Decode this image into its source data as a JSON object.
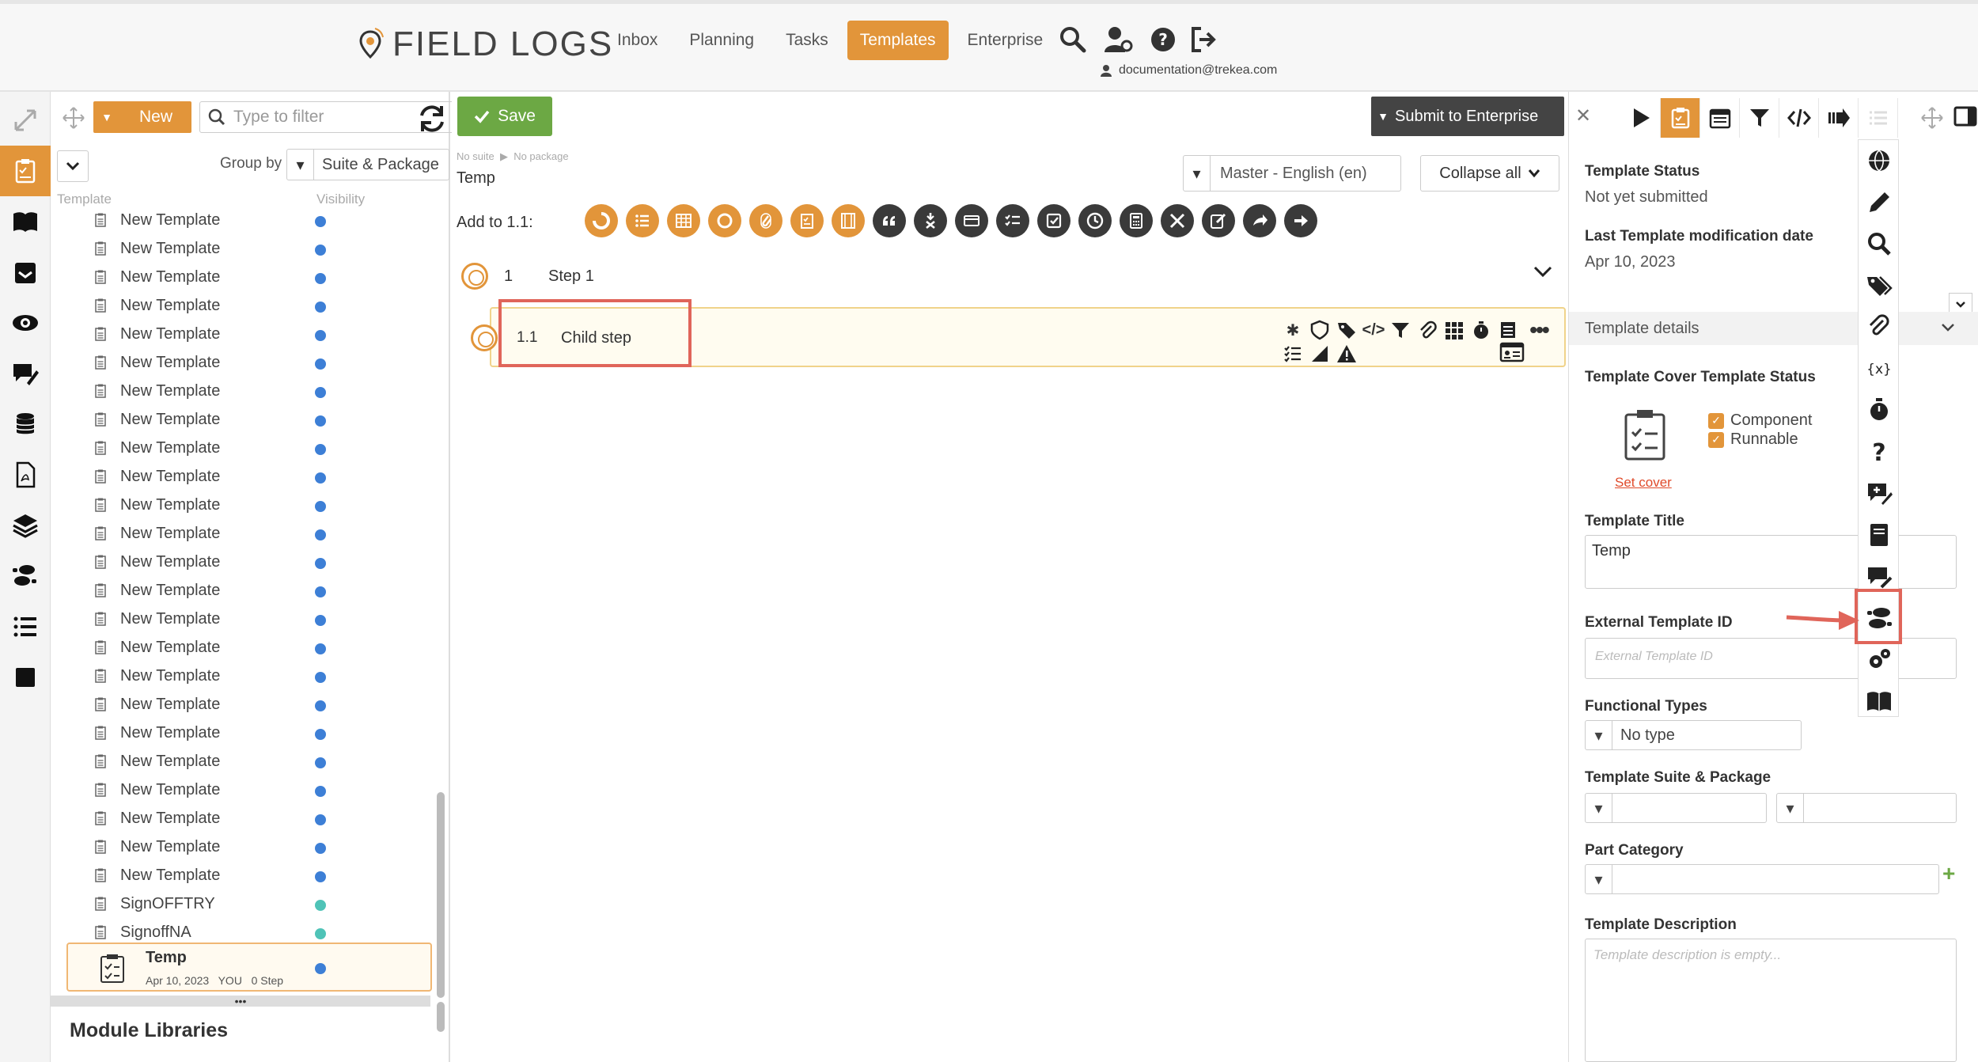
{
  "header": {
    "logo_text": "FIELD LOGS",
    "nav": [
      {
        "label": "Inbox",
        "active": false
      },
      {
        "label": "Planning",
        "active": false
      },
      {
        "label": "Tasks",
        "active": false
      },
      {
        "label": "Templates",
        "active": true
      },
      {
        "label": "Enterprise",
        "active": false
      }
    ],
    "user_email": "documentation@trekea.com",
    "icons": [
      "search-icon",
      "user-settings-icon",
      "help-icon",
      "logout-icon"
    ],
    "accent_color": "#e2953a"
  },
  "left_rail": {
    "icons": [
      "template-icon",
      "book-icon",
      "inbox-tray-icon",
      "eye-icon",
      "comment-edit-icon",
      "database-icon",
      "pdf-icon",
      "layers-icon",
      "footsteps-icon",
      "list-icon",
      "square-icon"
    ]
  },
  "list_panel": {
    "new_label": "New",
    "filter_placeholder": "Type to filter",
    "group_by_label": "Group by",
    "group_by_value": "Suite & Package",
    "col_template": "Template",
    "col_visibility": "Visibility",
    "templates": [
      {
        "name": "New Template",
        "dot": "blue"
      },
      {
        "name": "New Template",
        "dot": "blue"
      },
      {
        "name": "New Template",
        "dot": "blue"
      },
      {
        "name": "New Template",
        "dot": "blue"
      },
      {
        "name": "New Template",
        "dot": "blue"
      },
      {
        "name": "New Template",
        "dot": "blue"
      },
      {
        "name": "New Template",
        "dot": "blue"
      },
      {
        "name": "New Template",
        "dot": "blue"
      },
      {
        "name": "New Template",
        "dot": "blue"
      },
      {
        "name": "New Template",
        "dot": "blue"
      },
      {
        "name": "New Template",
        "dot": "blue"
      },
      {
        "name": "New Template",
        "dot": "blue"
      },
      {
        "name": "New Template",
        "dot": "blue"
      },
      {
        "name": "New Template",
        "dot": "blue"
      },
      {
        "name": "New Template",
        "dot": "blue"
      },
      {
        "name": "New Template",
        "dot": "blue"
      },
      {
        "name": "New Template",
        "dot": "blue"
      },
      {
        "name": "New Template",
        "dot": "blue"
      },
      {
        "name": "New Template",
        "dot": "blue"
      },
      {
        "name": "New Template",
        "dot": "blue"
      },
      {
        "name": "New Template",
        "dot": "blue"
      },
      {
        "name": "New Template",
        "dot": "blue"
      },
      {
        "name": "New Template",
        "dot": "blue"
      },
      {
        "name": "New Template",
        "dot": "blue"
      },
      {
        "name": "SignOFFTRY",
        "dot": "teal"
      },
      {
        "name": "SignoffNA",
        "dot": "teal"
      }
    ],
    "selected": {
      "name": "Temp",
      "date": "Apr 10, 2023",
      "owner": "YOU",
      "steps": "0 Step"
    },
    "module_libraries_label": "Module Libraries"
  },
  "editor": {
    "save_label": "Save",
    "submit_label": "Submit to Enterprise",
    "breadcrumb_suite": "No suite",
    "breadcrumb_package": "No package",
    "title": "Temp",
    "language": "Master - English (en)",
    "collapse_label": "Collapse all",
    "add_to_label": "Add to 1.1:",
    "add_icons": [
      {
        "name": "partial-circle-icon",
        "color": "orange"
      },
      {
        "name": "list-icon",
        "color": "orange"
      },
      {
        "name": "table-icon",
        "color": "orange"
      },
      {
        "name": "circle-icon",
        "color": "orange"
      },
      {
        "name": "attachment-icon",
        "color": "orange"
      },
      {
        "name": "checklist-icon",
        "color": "orange"
      },
      {
        "name": "film-icon",
        "color": "orange"
      },
      {
        "name": "quote-icon",
        "color": "dark"
      },
      {
        "name": "decision-icon",
        "color": "dark"
      },
      {
        "name": "card-icon",
        "color": "dark"
      },
      {
        "name": "checklist-dark-icon",
        "color": "dark"
      },
      {
        "name": "checkbox-icon",
        "color": "dark"
      },
      {
        "name": "clock-icon",
        "color": "dark"
      },
      {
        "name": "calculator-icon",
        "color": "dark"
      },
      {
        "name": "tools-icon",
        "color": "dark"
      },
      {
        "name": "edit-icon",
        "color": "dark"
      },
      {
        "name": "share-icon",
        "color": "dark"
      },
      {
        "name": "arrow-right-icon",
        "color": "dark"
      }
    ],
    "step1": {
      "num": "1",
      "label": "Step 1"
    },
    "child": {
      "num": "1.1",
      "label": "Child step"
    }
  },
  "right_panel": {
    "status_label": "Template Status",
    "status_value": "Not yet submitted",
    "modified_label": "Last Template modification date",
    "modified_value": "Apr 10, 2023",
    "details_label": "Template details",
    "cover_label": "Template Cover Template Status",
    "component_label": "Component",
    "runnable_label": "Runnable",
    "set_cover_label": "Set cover",
    "title_label": "Template Title",
    "title_value": "Temp",
    "external_id_label": "External Template ID",
    "external_id_placeholder": "External Template ID",
    "functional_types_label": "Functional Types",
    "functional_types_value": "No type",
    "suite_package_label": "Template Suite & Package",
    "part_category_label": "Part Category",
    "description_label": "Template Description",
    "description_placeholder": "Template description is empty..."
  },
  "float_column": {
    "icons": [
      "globe-icon",
      "pencil-icon",
      "search-icon",
      "tags-icon",
      "paperclip-icon",
      "variable-icon",
      "stopwatch-icon",
      "question-icon",
      "comment-plus-icon",
      "book-closed-icon",
      "comment-pen-icon",
      "footsteps-icon",
      "gears-icon",
      "open-book-icon"
    ],
    "highlighted": "footsteps-icon"
  }
}
